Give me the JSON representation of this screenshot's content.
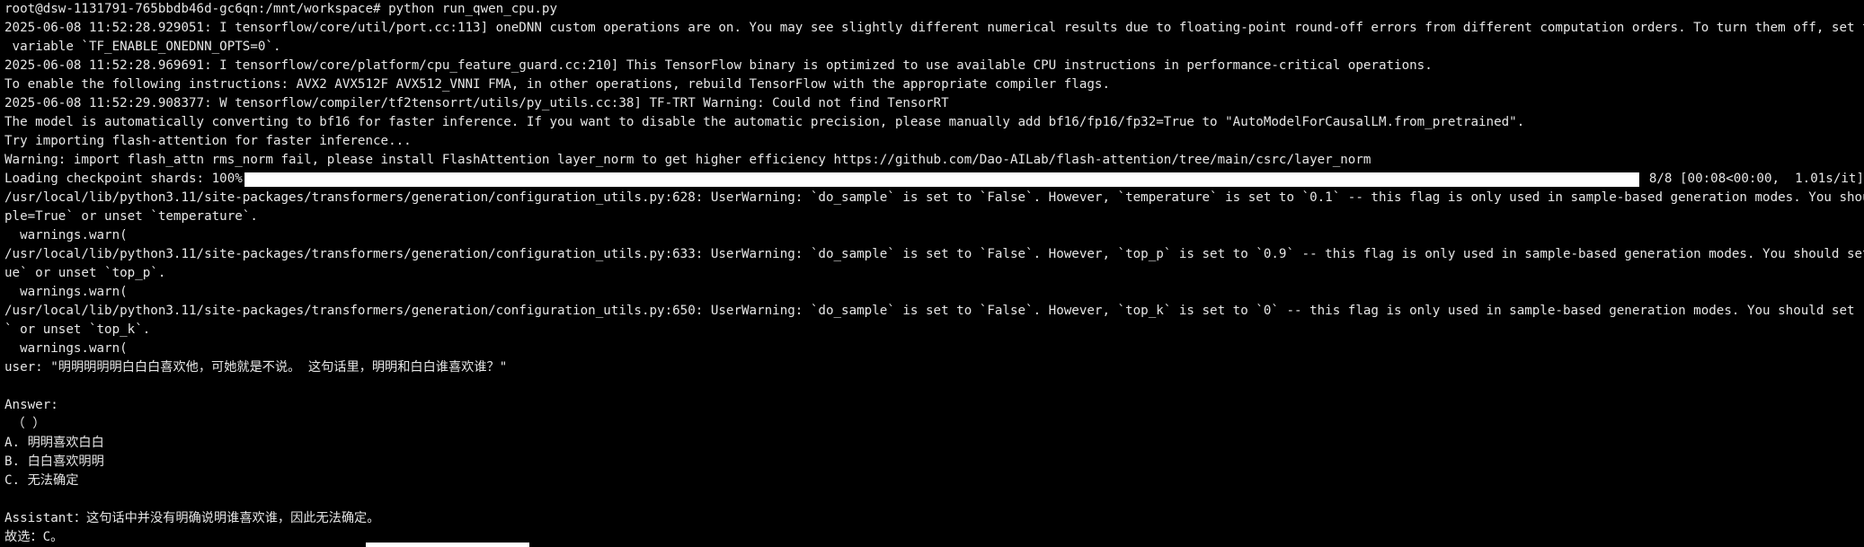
{
  "terminal": {
    "lines": [
      "root@dsw-1131791-765bbdb46d-gc6qn:/mnt/workspace# python run_qwen_cpu.py",
      "2025-06-08 11:52:28.929051: I tensorflow/core/util/port.cc:113] oneDNN custom operations are on. You may see slightly different numerical results due to floating-point round-off errors from different computation orders. To turn them off, set the environment",
      " variable `TF_ENABLE_ONEDNN_OPTS=0`.",
      "2025-06-08 11:52:28.969691: I tensorflow/core/platform/cpu_feature_guard.cc:210] This TensorFlow binary is optimized to use available CPU instructions in performance-critical operations.",
      "To enable the following instructions: AVX2 AVX512F AVX512_VNNI FMA, in other operations, rebuild TensorFlow with the appropriate compiler flags.",
      "2025-06-08 11:52:29.908377: W tensorflow/compiler/tf2tensorrt/utils/py_utils.cc:38] TF-TRT Warning: Could not find TensorRT",
      "The model is automatically converting to bf16 for faster inference. If you want to disable the automatic precision, please manually add bf16/fp16/fp32=True to \"AutoModelForCausalLM.from_pretrained\".",
      "Try importing flash-attention for faster inference...",
      "Warning: import flash_attn rms_norm fail, please install FlashAttention layer_norm to get higher efficiency https://github.com/Dao-AILab/flash-attention/tree/main/csrc/layer_norm"
    ],
    "progress": {
      "prefix": "Loading checkpoint shards: 100%",
      "fill_fraction": 1.0,
      "suffix": " 8/8 [00:08<00:00,  1.01s/it]"
    },
    "lines_after": [
      "/usr/local/lib/python3.11/site-packages/transformers/generation/configuration_utils.py:628: UserWarning: `do_sample` is set to `False`. However, `temperature` is set to `0.1` -- this flag is only used in sample-based generation modes. You should set `do_sam",
      "ple=True` or unset `temperature`.",
      "  warnings.warn(",
      "/usr/local/lib/python3.11/site-packages/transformers/generation/configuration_utils.py:633: UserWarning: `do_sample` is set to `False`. However, `top_p` is set to `0.9` -- this flag is only used in sample-based generation modes. You should set `do_sample=Tr",
      "ue` or unset `top_p`.",
      "  warnings.warn(",
      "/usr/local/lib/python3.11/site-packages/transformers/generation/configuration_utils.py:650: UserWarning: `do_sample` is set to `False`. However, `top_k` is set to `0` -- this flag is only used in sample-based generation modes. You should set `do_sample=True",
      "` or unset `top_k`.",
      "  warnings.warn(",
      "user: \"明明明明明白白白喜欢他，可她就是不说。 这句话里，明明和白白谁喜欢谁？\"",
      "",
      "Answer:",
      " （ ）",
      "A. 明明喜欢白白",
      "B. 白白喜欢明明",
      "C. 无法确定",
      "",
      "Assistant：这句话中并没有明确说明谁喜欢谁，因此无法确定。",
      "故选：C。"
    ]
  }
}
